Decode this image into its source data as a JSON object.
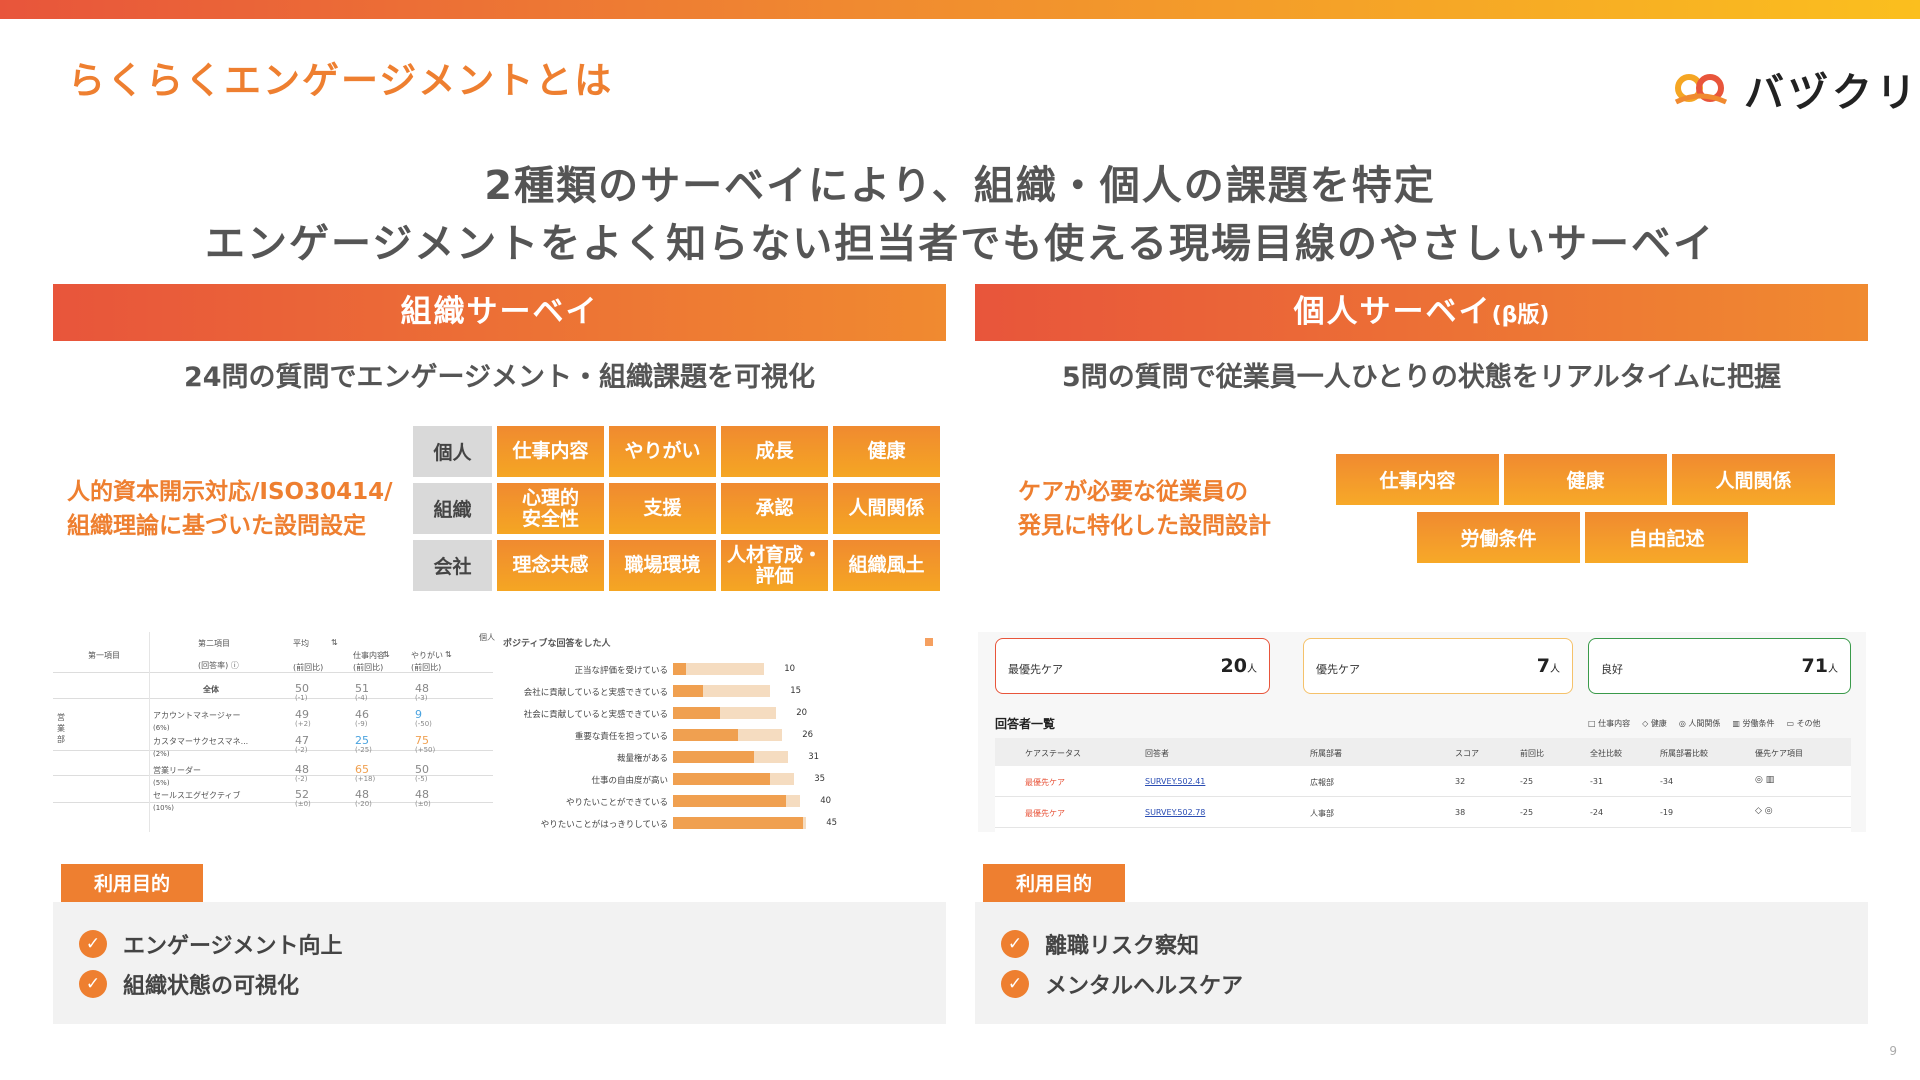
{
  "header": {
    "title": "らくらくエンゲージメントとは",
    "logo_text": "バヅクリ"
  },
  "headline": {
    "line1": "2種類のサーベイにより、組織・個人の課題を特定",
    "line2": "エンゲージメントをよく知らない担当者でも使える現場目線のやさしいサーベイ"
  },
  "org": {
    "title": "組織サーベイ",
    "subtitle": "24問の質問でエンゲージメント・組織課題を可視化",
    "note_line1": "人的資本開示対応/ISO30414/",
    "note_line2": "組織理論に基づいた設問設定",
    "rows": [
      {
        "cat": "個人",
        "tags": [
          "仕事内容",
          "やりがい",
          "成長",
          "健康"
        ]
      },
      {
        "cat": "組織",
        "tags": [
          "心理的\n安全性",
          "支援",
          "承認",
          "人間関係"
        ]
      },
      {
        "cat": "会社",
        "tags": [
          "理念共感",
          "職場環境",
          "人材育成・\n評価",
          "組織風土"
        ]
      }
    ],
    "table": {
      "h_first": "第一項目",
      "h_second": "第二項目",
      "h_respondents": "(回答率) ⓘ",
      "h_avg": "平均",
      "h_work": "仕事内容",
      "h_yarigai": "やりがい",
      "h_prev": "(前回比)",
      "h_extra": "個人",
      "sort_icon": "⇅",
      "rows": [
        {
          "first": "",
          "second": "全体",
          "pct": "",
          "avg": "50",
          "avg_d": "(-1)",
          "work": "51",
          "work_d": "(-4)",
          "yg": "48",
          "yg_d": "(-3)"
        },
        {
          "first": "営業部",
          "second": "アカウントマネージャー",
          "pct": "(6%)",
          "avg": "49",
          "avg_d": "(+2)",
          "work": "46",
          "work_d": "(-9)",
          "yg": "9",
          "yg_d": "(-50)"
        },
        {
          "first": "",
          "second": "カスタマーサクセスマネ...",
          "pct": "(2%)",
          "avg": "47",
          "avg_d": "(-2)",
          "work": "25",
          "work_d": "(-25)",
          "yg": "75",
          "yg_d": "(+50)"
        },
        {
          "first": "",
          "second": "営業リーダー",
          "pct": "(5%)",
          "avg": "48",
          "avg_d": "(-2)",
          "work": "65",
          "work_d": "(+18)",
          "yg": "50",
          "yg_d": "(-5)"
        },
        {
          "first": "",
          "second": "セールスエグゼクティブ",
          "pct": "(10%)",
          "avg": "52",
          "avg_d": "(±0)",
          "work": "48",
          "work_d": "(-20)",
          "yg": "48",
          "yg_d": "(±0)"
        }
      ]
    },
    "chart_data": {
      "type": "bar",
      "title": "ポジティブな回答をした人",
      "categories": [
        "正当な評価を受けている",
        "会社に貢献していると実感できている",
        "社会に貢献していると実感できている",
        "重要な責任を担っている",
        "裁量権がある",
        "仕事の自由度が高い",
        "やりたいことができている",
        "やりたいことがはっきりしている"
      ],
      "values": [
        10,
        15,
        20,
        26,
        31,
        35,
        40,
        45
      ],
      "xlim": [
        0,
        50
      ]
    },
    "purpose_label": "利用目的",
    "purposes": [
      "エンゲージメント向上",
      "組織状態の可視化"
    ]
  },
  "personal": {
    "title": "個人サーベイ",
    "title_suffix": "(β版)",
    "subtitle": "5問の質問で従業員一人ひとりの状態をリアルタイムに把握",
    "note_line1": "ケアが必要な従業員の",
    "note_line2": "発見に特化した設問設計",
    "tags": [
      "仕事内容",
      "健康",
      "人間関係",
      "労働条件",
      "自由記述"
    ],
    "cards": [
      {
        "name": "最優先ケア",
        "count": "20",
        "unit": "人",
        "color": "#e8553b"
      },
      {
        "name": "優先ケア",
        "count": "7",
        "unit": "人",
        "color": "#f5c26b"
      },
      {
        "name": "良好",
        "count": "71",
        "unit": "人",
        "color": "#3a9a4a"
      }
    ],
    "list_title": "回答者一覧",
    "filters": [
      "仕事内容",
      "健康",
      "人間関係",
      "労働条件",
      "その他"
    ],
    "columns": [
      "ケアステータス",
      "回答者",
      "所属部署",
      "スコア",
      "前回比",
      "全社比較",
      "所属部署比較",
      "優先ケア項目"
    ],
    "rows": [
      {
        "status": "最優先ケア",
        "user": "SURVEY.502.41",
        "dept": "広報部",
        "score": "32",
        "prev": "-25",
        "company": "-31",
        "deptcmp": "-34"
      },
      {
        "status": "最優先ケア",
        "user": "SURVEY.502.78",
        "dept": "人事部",
        "score": "38",
        "prev": "-25",
        "company": "-24",
        "deptcmp": "-19"
      }
    ],
    "purpose_label": "利用目的",
    "purposes": [
      "離職リスク察知",
      "メンタルヘルスケア"
    ]
  },
  "page_number": "9",
  "colors": {
    "accent": "#ee7f30",
    "red": "#e8553b",
    "yellow": "#fbbf1e"
  }
}
